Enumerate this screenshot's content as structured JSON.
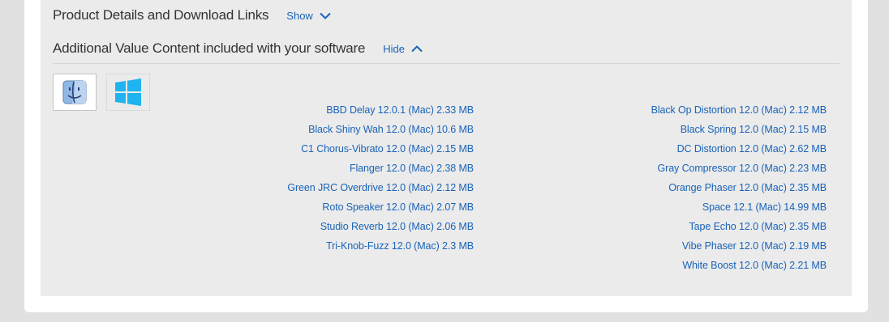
{
  "sections": {
    "product": {
      "title": "Product Details and Download Links",
      "toggle_label": "Show"
    },
    "additional": {
      "title": "Additional Value Content included with your software",
      "toggle_label": "Hide"
    }
  },
  "os_tabs": [
    {
      "name": "mac",
      "icon": "mac-finder-icon",
      "selected": true
    },
    {
      "name": "windows",
      "icon": "windows-icon",
      "selected": false
    }
  ],
  "downloads_left": [
    "BBD Delay 12.0.1 (Mac) 2.33 MB",
    "Black Shiny Wah 12.0 (Mac) 10.6 MB",
    "C1 Chorus-Vibrato 12.0 (Mac) 2.15 MB",
    "Flanger 12.0 (Mac) 2.38 MB",
    "Green JRC Overdrive 12.0 (Mac) 2.12 MB",
    "Roto Speaker 12.0 (Mac) 2.07 MB",
    "Studio Reverb 12.0 (Mac) 2.06 MB",
    "Tri-Knob-Fuzz 12.0 (Mac) 2.3 MB"
  ],
  "downloads_right": [
    "Black Op Distortion 12.0 (Mac) 2.12 MB",
    "Black Spring 12.0 (Mac) 2.15 MB",
    "DC Distortion 12.0 (Mac) 2.62 MB",
    "Gray Compressor 12.0 (Mac) 2.23 MB",
    "Orange Phaser 12.0 (Mac) 2.35 MB",
    "Space 12.1 (Mac) 14.99 MB",
    "Tape Echo 12.0 (Mac) 2.35 MB",
    "Vibe Phaser 12.0 (Mac) 2.19 MB",
    "White Boost 12.0 (Mac) 2.21 MB"
  ],
  "colors": {
    "link": "#1a63b8",
    "panel": "#ebebeb",
    "page": "#e1e1e1"
  }
}
